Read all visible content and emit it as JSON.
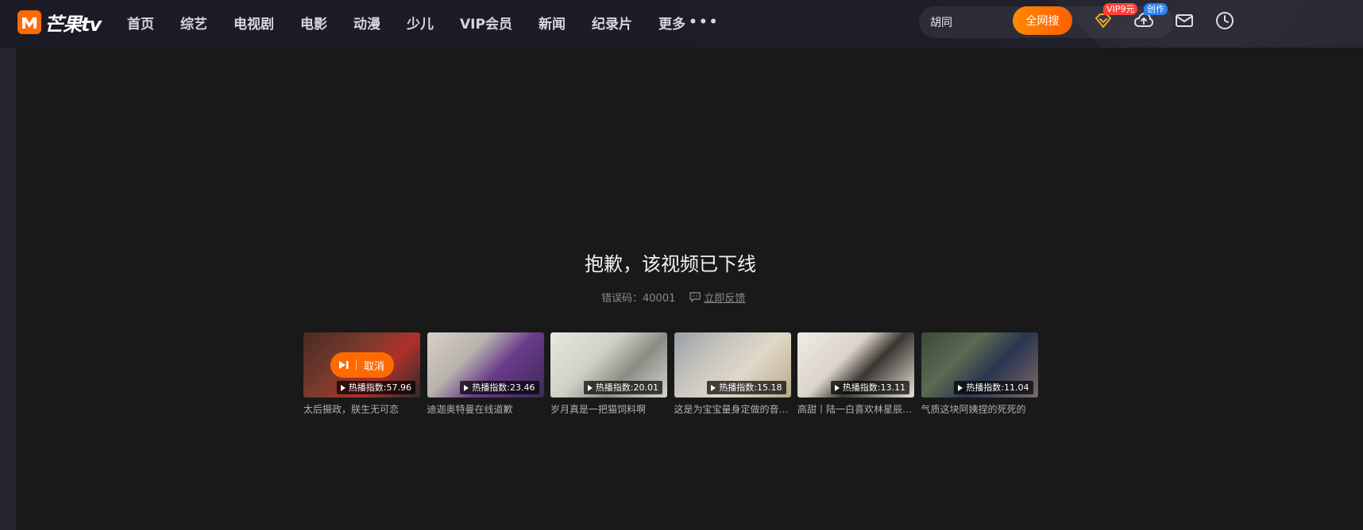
{
  "brand": {
    "name": "芒果tv"
  },
  "nav": [
    {
      "label": "首页"
    },
    {
      "label": "综艺"
    },
    {
      "label": "电视剧"
    },
    {
      "label": "电影"
    },
    {
      "label": "动漫"
    },
    {
      "label": "少儿"
    },
    {
      "label": "VIP会员"
    },
    {
      "label": "新闻"
    },
    {
      "label": "纪录片"
    },
    {
      "label": "更多"
    }
  ],
  "search": {
    "value": "胡同",
    "button": "全网搜"
  },
  "header_icons": {
    "vip_badge": "VIP9元",
    "create_badge": "创作"
  },
  "error": {
    "title": "抱歉，该视频已下线",
    "code_label": "错误码：40001",
    "feedback": "立即反馈"
  },
  "recommendations": [
    {
      "title": "太后摄政，朕生无可恋",
      "heat": "热播指数:57.96",
      "cancel": "取消"
    },
    {
      "title": "迪迦奥特曼在线道歉",
      "heat": "热播指数:23.46"
    },
    {
      "title": "岁月真是一把猫饲料啊",
      "heat": "热播指数:20.01"
    },
    {
      "title": "这是为宝宝量身定做的音乐么",
      "heat": "热播指数:15.18"
    },
    {
      "title": "高甜丨陆一白喜欢林星辰时…",
      "heat": "热播指数:13.11"
    },
    {
      "title": "气质这块阿姨捏的死死的",
      "heat": "热播指数:11.04"
    }
  ],
  "colors": {
    "accent": "#ff6a00",
    "background": "#191919",
    "topbar": "#1b1b26"
  }
}
